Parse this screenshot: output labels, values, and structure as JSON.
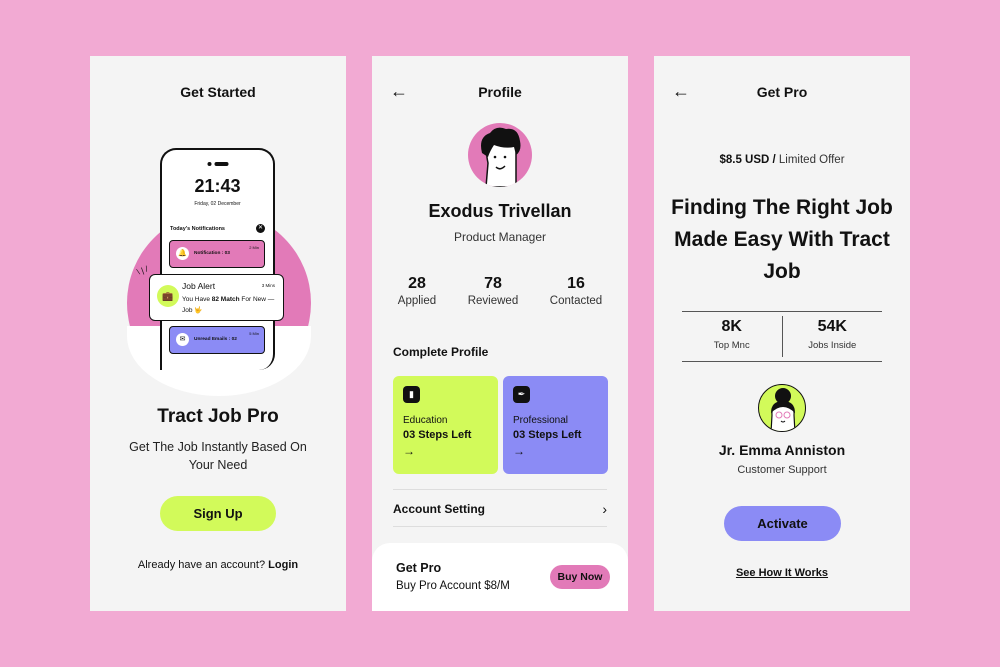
{
  "colors": {
    "background": "#f2aad3",
    "panel": "#f4f4f4",
    "lime": "#d2fa5a",
    "pink": "#e27ab8",
    "purple": "#8b8bf5",
    "ink": "#111111"
  },
  "screen1": {
    "header": "Get Started",
    "phone": {
      "time": "21:43",
      "date": "Friday, 02 December",
      "notifications_title": "Today's Notifications",
      "close_icon": "close-icon",
      "cards": [
        {
          "icon": "bell-icon",
          "label": "Notification : 03",
          "time": "2 Min"
        },
        {
          "icon": "mail-icon",
          "label": "Unread Emails : 02",
          "time": "5 Min"
        }
      ],
      "alert": {
        "icon": "briefcase-icon",
        "title": "Job Alert",
        "time": "3 Mins",
        "message_prefix": "You Have ",
        "message_bold": "82 Match",
        "message_suffix": " For New — Job 🤟"
      }
    },
    "title": "Tract Job Pro",
    "subtitle": "Get The Job Instantly Based On Your Need",
    "signup_label": "Sign Up",
    "login_prompt": "Already have an account?",
    "login_label": "Login"
  },
  "screen2": {
    "header": "Profile",
    "back_icon": "arrow-left-icon",
    "name": "Exodus Trivellan",
    "role": "Product Manager",
    "stats": [
      {
        "value": "28",
        "label": "Applied"
      },
      {
        "value": "78",
        "label": "Reviewed"
      },
      {
        "value": "16",
        "label": "Contacted"
      }
    ],
    "section_title": "Complete Profile",
    "cards": [
      {
        "icon": "book-icon",
        "name": "Education",
        "steps": "03 Steps Left",
        "arrow": "→"
      },
      {
        "icon": "pen-nib-icon",
        "name": "Professional",
        "steps": "03 Steps Left",
        "arrow": "→"
      }
    ],
    "account_setting": "Account Setting",
    "get_pro": {
      "title": "Get Pro",
      "subtitle": "Buy Pro Account $8/M",
      "button": "Buy Now"
    }
  },
  "screen3": {
    "header": "Get Pro",
    "back_icon": "arrow-left-icon",
    "price": "$8.5 USD /",
    "price_note": "Limited Offer",
    "headline": "Finding The Right Job Made Easy With Tract Job",
    "stats": [
      {
        "value": "8K",
        "label": "Top Mnc"
      },
      {
        "value": "54K",
        "label": "Jobs Inside"
      }
    ],
    "name": "Jr. Emma Anniston",
    "role": "Customer Support",
    "activate_label": "Activate",
    "how_link": "See How It Works"
  }
}
